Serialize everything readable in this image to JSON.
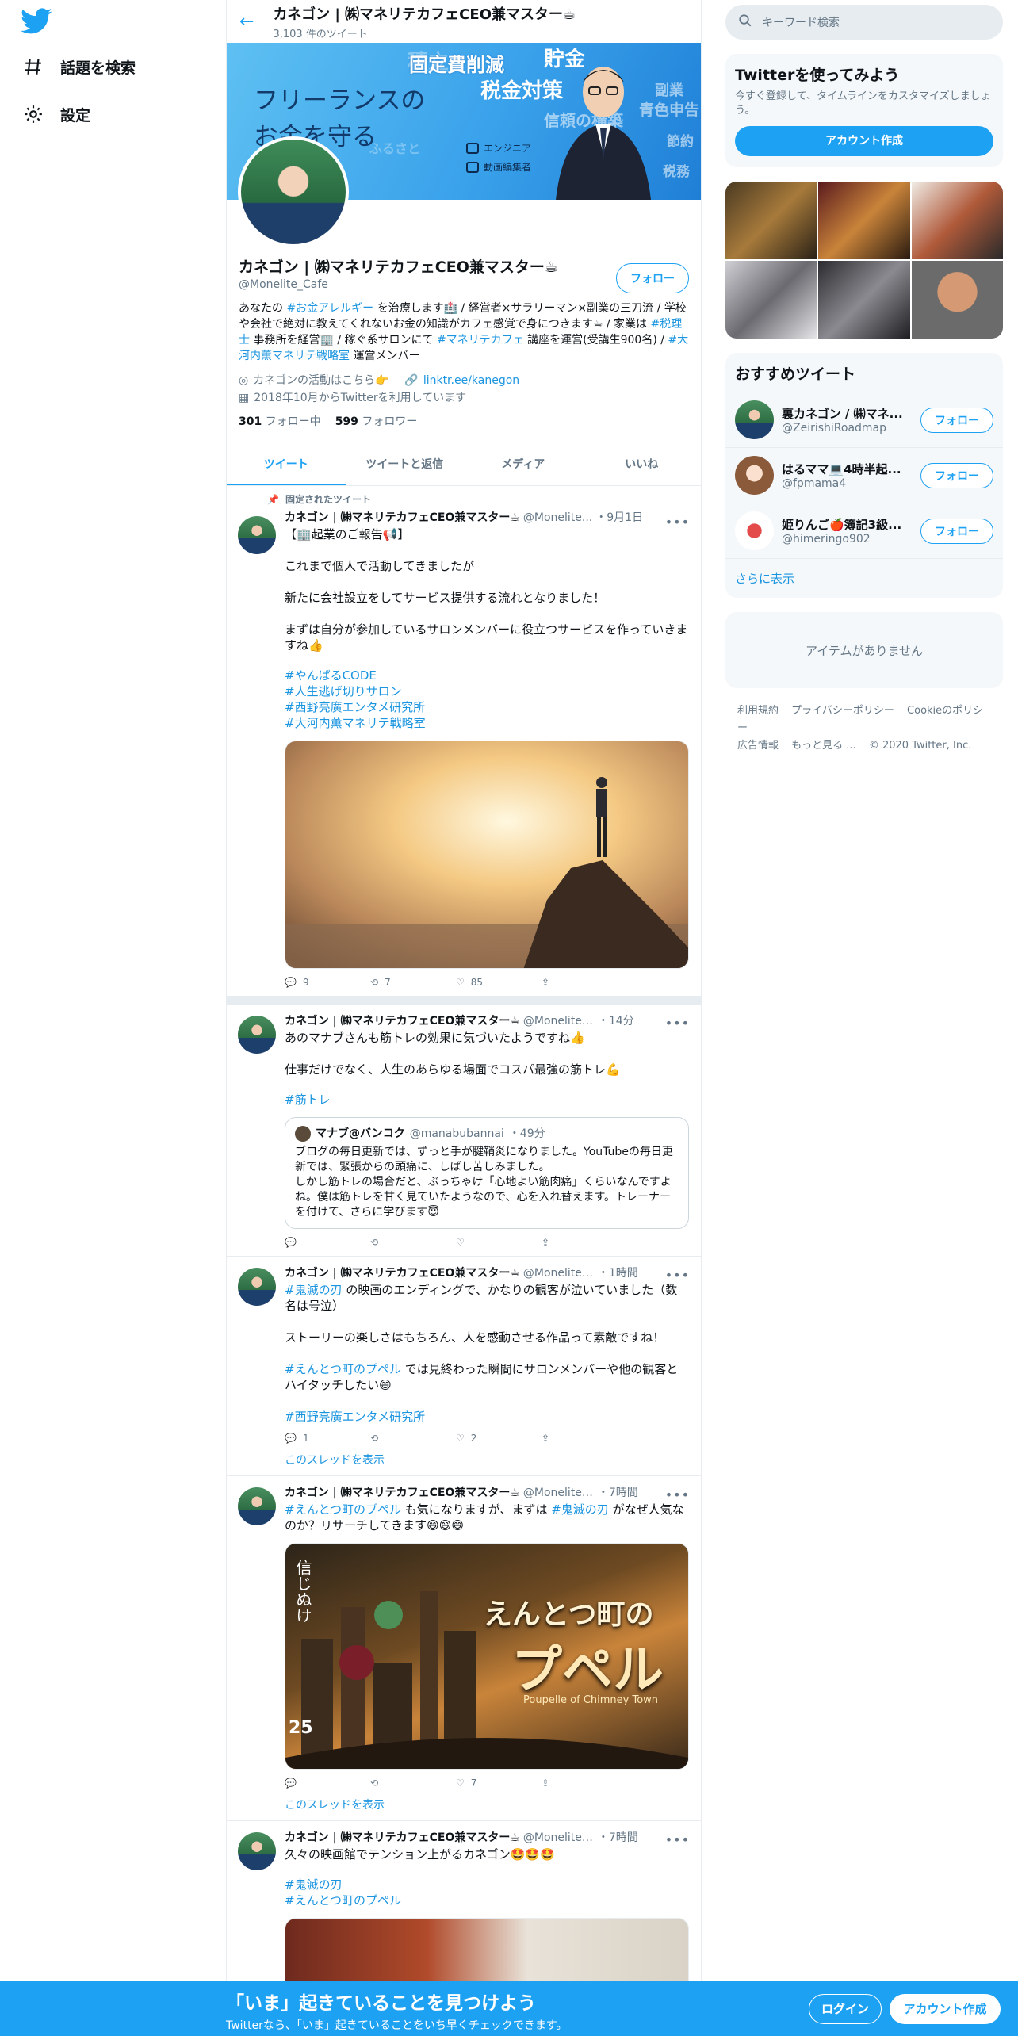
{
  "nav": {
    "items": [
      {
        "label": "話題を検索",
        "icon": "hashtag-icon"
      },
      {
        "label": "設定",
        "icon": "gear-icon"
      }
    ]
  },
  "header": {
    "name": "カネゴン | ㈱マネリテカフェCEO兼マスター☕",
    "count": "3,103 件のツイート"
  },
  "banner": {
    "line1": "フリーランスの",
    "line2": "お金を守る",
    "tag1": "エンジニア",
    "tag2": "動画編集者",
    "w1": "固定費削減",
    "w2": "貯金",
    "w3": "税金対策",
    "w4": "信頼の構築",
    "w5": "副業",
    "w6": "税務",
    "w7": "節約",
    "w8": "青色申告",
    "w9": "ふるさと",
    "w10": "積立"
  },
  "profile": {
    "name": "カネゴン | ㈱マネリテカフェCEO兼マスター☕",
    "handle": "@Monelite_Cafe",
    "follow_label": "フォロー",
    "bio_1": "あなたの ",
    "bio_tag1": "#お金アレルギー",
    "bio_2": " を治療します🏥 / 経営者×サラリーマン×副業の三刀流 / 学校や会社で絶対に教えてくれないお金の知識がカフェ感覚で身につきます☕ / 家業は ",
    "bio_tag2": "#税理士",
    "bio_3": " 事務所を経営🏢 / 稼ぐ系サロンにて ",
    "bio_tag3": "#マネリテカフェ",
    "bio_4": " 講座を運営(受講生900名) / ",
    "bio_tag4": "#大河内薫マネリテ戦略室",
    "bio_5": " 運営メンバー",
    "location": "カネゴンの活動はこちら👉",
    "link": "linktr.ee/kanegon",
    "joined": "2018年10月からTwitterを利用しています",
    "following_n": "301",
    "following_l": "フォロー中",
    "followers_n": "599",
    "followers_l": "フォロワー"
  },
  "tabs": [
    "ツイート",
    "ツイートと返信",
    "メディア",
    "いいね"
  ],
  "tweets": [
    {
      "pinned": "固定されたツイート",
      "name": "カネゴン | ㈱マネリテカフェCEO兼マスター☕",
      "handle": "@Monelite...",
      "time": "・9月1日",
      "body": "【🏢起業のご報告📢】\n\nこれまで個人で活動してきましたが\n\n新たに会社設立をしてサービス提供する流れとなりました！\n\nまずは自分が参加しているサロンメンバーに役立つサービスを作っていきますね👍",
      "tags": "#やんばるCODE\n#人生逃げ切りサロン\n#西野亮廣エンタメ研究所\n#大河内薫マネリテ戦略室",
      "reply": "9",
      "retweet": "7",
      "like": "85"
    },
    {
      "name": "カネゴン | ㈱マネリテカフェCEO兼マスター☕",
      "handle": "@Monelite_...",
      "time": "・14分",
      "body": "あのマナブさんも筋トレの効果に気づいたようですね👍\n\n仕事だけでなく、人生のあらゆる場面でコスパ最強の筋トレ💪",
      "tags": "#筋トレ",
      "quote_name": "マナブ@バンコク",
      "quote_handle": "@manabubannai",
      "quote_time": "・49分",
      "quote_body": "ブログの毎日更新では、ずっと手が腱鞘炎になりました。YouTubeの毎日更新では、緊張からの頭痛に、しばし苦しみました。\nしかし筋トレの場合だと、ぶっちゃけ「心地よい筋肉痛」くらいなんですよね。僕は筋トレを甘く見ていたようなので、心を入れ替えます。トレーナーを付けて、さらに学びます😇"
    },
    {
      "name": "カネゴン | ㈱マネリテカフェCEO兼マスター☕",
      "handle": "@Monelite_...",
      "time": "・1時間",
      "tag_a": "#鬼滅の刃",
      "body_a": " の映画のエンディングで、かなりの観客が泣いていました（数名は号泣）\n\nストーリーの楽しさはもちろん、人を感動させる作品って素敵ですね！\n\n",
      "tag_b": "#えんとつ町のプペル",
      "body_b": " では見終わった瞬間にサロンメンバーや他の観客とハイタッチしたい😄\n\n",
      "tag_c": "#西野亮廣エンタメ研究所",
      "reply": "1",
      "like": "2",
      "thread": "このスレッドを表示"
    },
    {
      "name": "カネゴン | ㈱マネリテカフェCEO兼マスター☕",
      "handle": "@Monelite_...",
      "time": "・7時間",
      "tag_a": "#えんとつ町のプペル",
      "body_a": " も気になりますが、まずは ",
      "tag_b": "#鬼滅の刃",
      "body_b": " がなぜ人気なのか？リサーチしてきます😄😄😄",
      "poster_title": "えんとつ町の",
      "poster_big": "プペル",
      "poster_sub": "Poupelle of Chimney Town",
      "poster_date": "25",
      "poster_catch": "信じぬけ",
      "like": "7",
      "thread": "このスレッドを表示"
    },
    {
      "name": "カネゴン | ㈱マネリテカフェCEO兼マスター☕",
      "handle": "@Monelite_...",
      "time": "・7時間",
      "body": "久々の映画館でテンション上がるカネゴン🤩🤩🤩",
      "tags": "#鬼滅の刃\n#えんとつ町のプペル"
    }
  ],
  "right": {
    "search_placeholder": "キーワード検索",
    "signup_title": "Twitterを使ってみよう",
    "signup_sub": "今すぐ登録して、タイムラインをカスタマイズしましょう。",
    "signup_btn": "アカウント作成",
    "rec_title": "おすすめツイート",
    "recs": [
      {
        "name": "裏カネゴン / ㈱マネ...",
        "handle": "@ZeirishiRoadmap"
      },
      {
        "name": "はるママ💻4時半起...",
        "handle": "@fpmama4"
      },
      {
        "name": "姫りんご🍎簿記3級...",
        "handle": "@himeringo902"
      }
    ],
    "follow_label": "フォロー",
    "show_more": "さらに表示",
    "empty": "アイテムがありません",
    "footer": [
      "利用規約",
      "プライバシーポリシー",
      "Cookieのポリシー",
      "広告情報",
      "もっと見る ...",
      "© 2020 Twitter, Inc."
    ]
  },
  "bottom": {
    "title": "「いま」起きていることを見つけよう",
    "sub": "Twitterなら、「いま」起きていることをいち早くチェックできます。",
    "login": "ログイン",
    "signup": "アカウント作成"
  },
  "colors": {
    "accent": "#1da1f2",
    "link": "#1b95e0",
    "muted": "#657786"
  }
}
